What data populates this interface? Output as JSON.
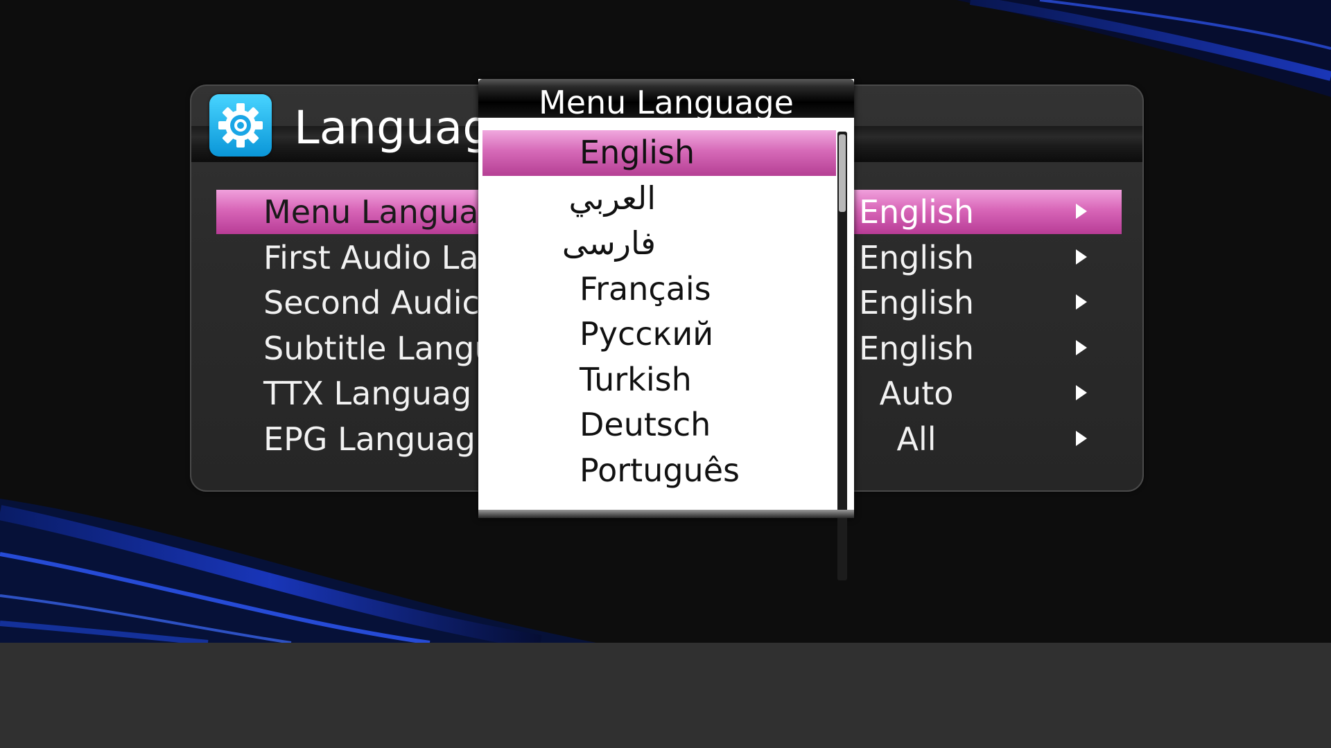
{
  "panel": {
    "title": "Languag",
    "icon": "gear-icon",
    "icon_color": "#1cb4f0",
    "highlight_color": "#d866b8"
  },
  "menu_rows": [
    {
      "label": "Menu Langua",
      "value": "English",
      "selected": true
    },
    {
      "label": "First Audio La",
      "value": "English",
      "selected": false
    },
    {
      "label": "Second Audic",
      "value": "English",
      "selected": false
    },
    {
      "label": "Subtitle Langu",
      "value": "English",
      "selected": false
    },
    {
      "label": "TTX Languag",
      "value": "Auto",
      "selected": false
    },
    {
      "label": "EPG Languag",
      "value": "All",
      "selected": false
    }
  ],
  "popup": {
    "title": "Menu Language",
    "options": [
      {
        "label": "English",
        "selected": true
      },
      {
        "label": "العربي",
        "selected": false
      },
      {
        "label": "فارسی",
        "selected": false
      },
      {
        "label": "Français",
        "selected": false
      },
      {
        "label": "Русский",
        "selected": false
      },
      {
        "label": "Turkish",
        "selected": false
      },
      {
        "label": "Deutsch",
        "selected": false
      },
      {
        "label": "Português",
        "selected": false
      }
    ]
  }
}
